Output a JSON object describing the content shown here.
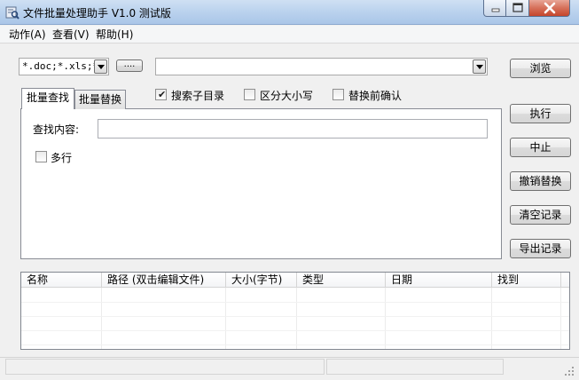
{
  "window": {
    "title": "文件批量处理助手  V1.0 测试版"
  },
  "menu": [
    {
      "label": "动作(A)"
    },
    {
      "label": "查看(V)"
    },
    {
      "label": "帮助(H)"
    }
  ],
  "filter": {
    "value": "*.doc;*.xls;*",
    "dots_label": "...."
  },
  "path_combo": {
    "value": ""
  },
  "buttons": {
    "browse": "浏览",
    "execute": "执行",
    "stop": "中止",
    "undo_replace": "撤销替换",
    "clear_log": "清空记录",
    "export_log": "导出记录"
  },
  "tabs": [
    {
      "label": "批量查找",
      "active": true
    },
    {
      "label": "批量替换",
      "active": false
    }
  ],
  "options": {
    "search_subdirs": {
      "label": "搜索子目录",
      "checked": true
    },
    "case_sensitive": {
      "label": "区分大小写",
      "checked": false
    },
    "confirm_replace": {
      "label": "替换前确认",
      "checked": false
    }
  },
  "find": {
    "label": "查找内容:",
    "value": "",
    "multiline": {
      "label": "多行",
      "checked": false
    }
  },
  "table": {
    "columns": [
      "名称",
      "路径 (双击编辑文件)",
      "大小(字节)",
      "类型",
      "日期",
      "找到"
    ],
    "rows": []
  },
  "icons": {
    "app": "app-icon",
    "minimize": "minimize-icon",
    "maximize": "maximize-icon",
    "close": "close-icon"
  }
}
